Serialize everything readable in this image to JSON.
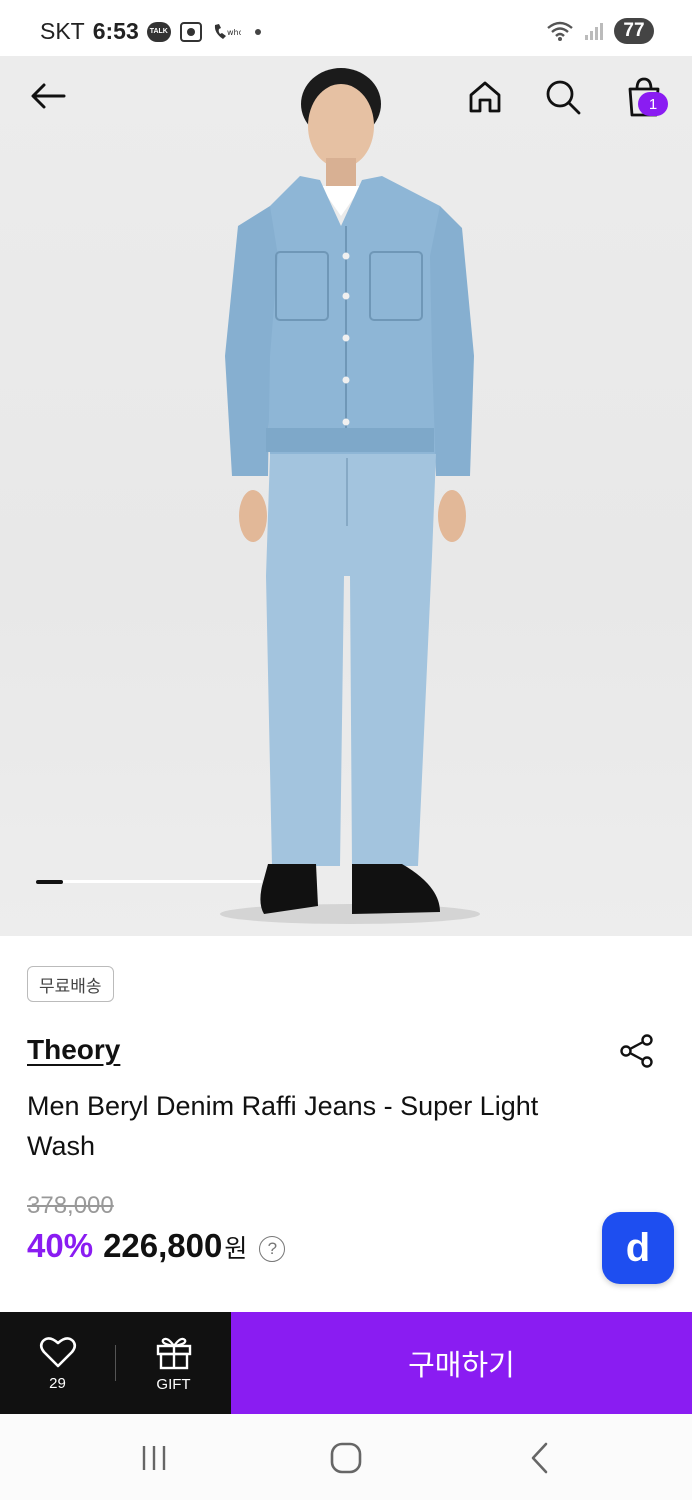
{
  "status_bar": {
    "carrier": "SKT",
    "time": "6:53",
    "talk_label": "TALK",
    "battery": "77"
  },
  "header": {
    "back_icon": "arrow-left-icon",
    "home_icon": "home-icon",
    "search_icon": "search-icon",
    "cart_icon": "shopping-bag-icon",
    "cart_count": "1"
  },
  "carousel": {
    "image": "product-photo-denim-model",
    "current_slide_fraction": 0.12
  },
  "product": {
    "badge": "무료배송",
    "brand": "Theory",
    "title": "Men Beryl Denim Raffi Jeans - Super Light Wash",
    "original_price": "378,000",
    "discount": "40%",
    "price": "226,800",
    "currency": "원",
    "help": "?",
    "chat_button_label": "d"
  },
  "purchase_bar": {
    "like_count": "29",
    "gift_label": "GIFT",
    "buy_label": "구매하기"
  },
  "colors": {
    "accent": "#8a1cf2",
    "dark": "#111111",
    "chat_blue": "#1e4ef0"
  }
}
